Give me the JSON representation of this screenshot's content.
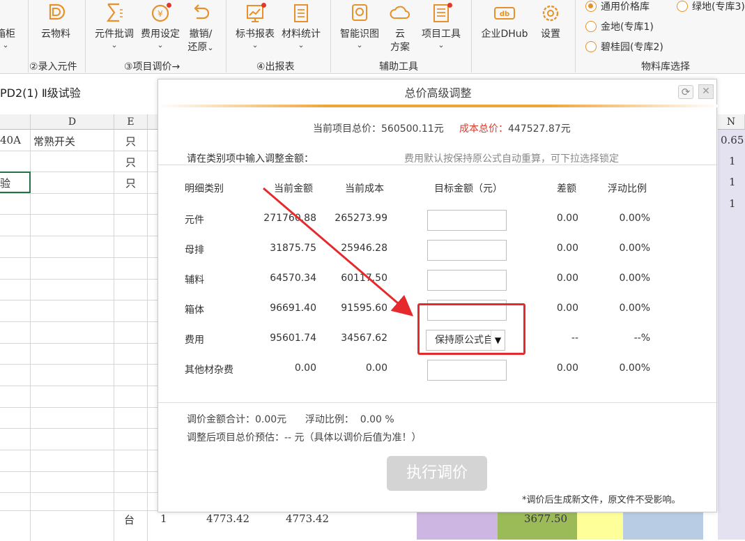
{
  "ribbon": {
    "buttons": [
      {
        "label": "箱柜",
        "chev": "⌄"
      },
      {
        "label": "云物料",
        "chev": ""
      },
      {
        "label": "元件批调",
        "chev": "⌄"
      },
      {
        "label": "费用设定",
        "chev": "⌄"
      },
      {
        "label": "撤销/",
        "label2": "还原",
        "chev": "⌄"
      },
      {
        "label": "标书报表",
        "chev": "⌄"
      },
      {
        "label": "材料统计",
        "chev": "⌄"
      },
      {
        "label": "智能识图",
        "chev": "⌄"
      },
      {
        "label": "云",
        "label2": "方案"
      },
      {
        "label": "项目工具",
        "chev": "⌄"
      },
      {
        "label": "企业DHub"
      },
      {
        "label": "设置"
      }
    ],
    "groups": [
      "②录入元件",
      "③项目调价→",
      "④出报表",
      "辅助工具",
      "物料库选择"
    ],
    "radios": [
      {
        "label": "通用价格库",
        "checked": true
      },
      {
        "label": "绿地(专库3)",
        "checked": false
      },
      {
        "label": "金地(专库1)",
        "checked": false
      },
      {
        "label": "碧桂园(专库2)",
        "checked": false
      }
    ]
  },
  "sheet": {
    "title": "PD2(1) Ⅱ级试验",
    "col_headers": [
      "D",
      "E",
      "N"
    ],
    "rows": [
      {
        "c": "40A",
        "d": "常熟开关",
        "e": "只",
        "n": "0.65"
      },
      {
        "c": "",
        "d": "",
        "e": "只",
        "n": "1"
      },
      {
        "c": "验",
        "d": "",
        "e": "只",
        "n": "1"
      },
      {
        "c": "",
        "d": "",
        "e": "",
        "n": "1"
      }
    ],
    "bottom_row": {
      "unit": "台",
      "qty": "1",
      "v1": "4773.42",
      "v2": "4773.42",
      "v3": "3677.50"
    }
  },
  "dialog": {
    "title": "总价高级调整",
    "current_total_label": "当前项目总价：",
    "current_total_value": "560500.11元",
    "cost_total_label": "成本总价：",
    "cost_total_value": "447527.87元",
    "hint_left": "请在类别项中输入调整金额：",
    "hint_right": "费用默认按保持原公式自动重算，可下拉选择锁定",
    "headers": [
      "明细类别",
      "当前金额",
      "当前成本",
      "目标金额（元）",
      "差额",
      "浮动比例"
    ],
    "rows": [
      {
        "category": "元件",
        "amount": "271760.88",
        "cost": "265273.99",
        "diff": "0.00",
        "ratio": "0.00%"
      },
      {
        "category": "母排",
        "amount": "31875.75",
        "cost": "25946.28",
        "diff": "0.00",
        "ratio": "0.00%"
      },
      {
        "category": "辅料",
        "amount": "64570.34",
        "cost": "60117.50",
        "diff": "0.00",
        "ratio": "0.00%"
      },
      {
        "category": "箱体",
        "amount": "96691.40",
        "cost": "91595.60",
        "diff": "0.00",
        "ratio": "0.00%"
      },
      {
        "category": "费用",
        "amount": "95601.74",
        "cost": "34567.62",
        "diff": "--",
        "ratio": "--%",
        "select": "保持原公式自"
      },
      {
        "category": "其他材杂费",
        "amount": "0.00",
        "cost": "0.00",
        "diff": "0.00",
        "ratio": "0.00%"
      }
    ],
    "sum_label": "调价金额合计：",
    "sum_value": "0.00元",
    "float_label": "浮动比例：",
    "float_value": "0.00 %",
    "estimate": "调整后项目总价预估：-- 元（具体以调价后值为准！）",
    "exec_label": "执行调价",
    "note": "*调价后生成新文件，原文件不受影响。"
  },
  "colors": {
    "accent": "#f0a53a",
    "red": "#e5292d",
    "radio": "#e6912b"
  }
}
